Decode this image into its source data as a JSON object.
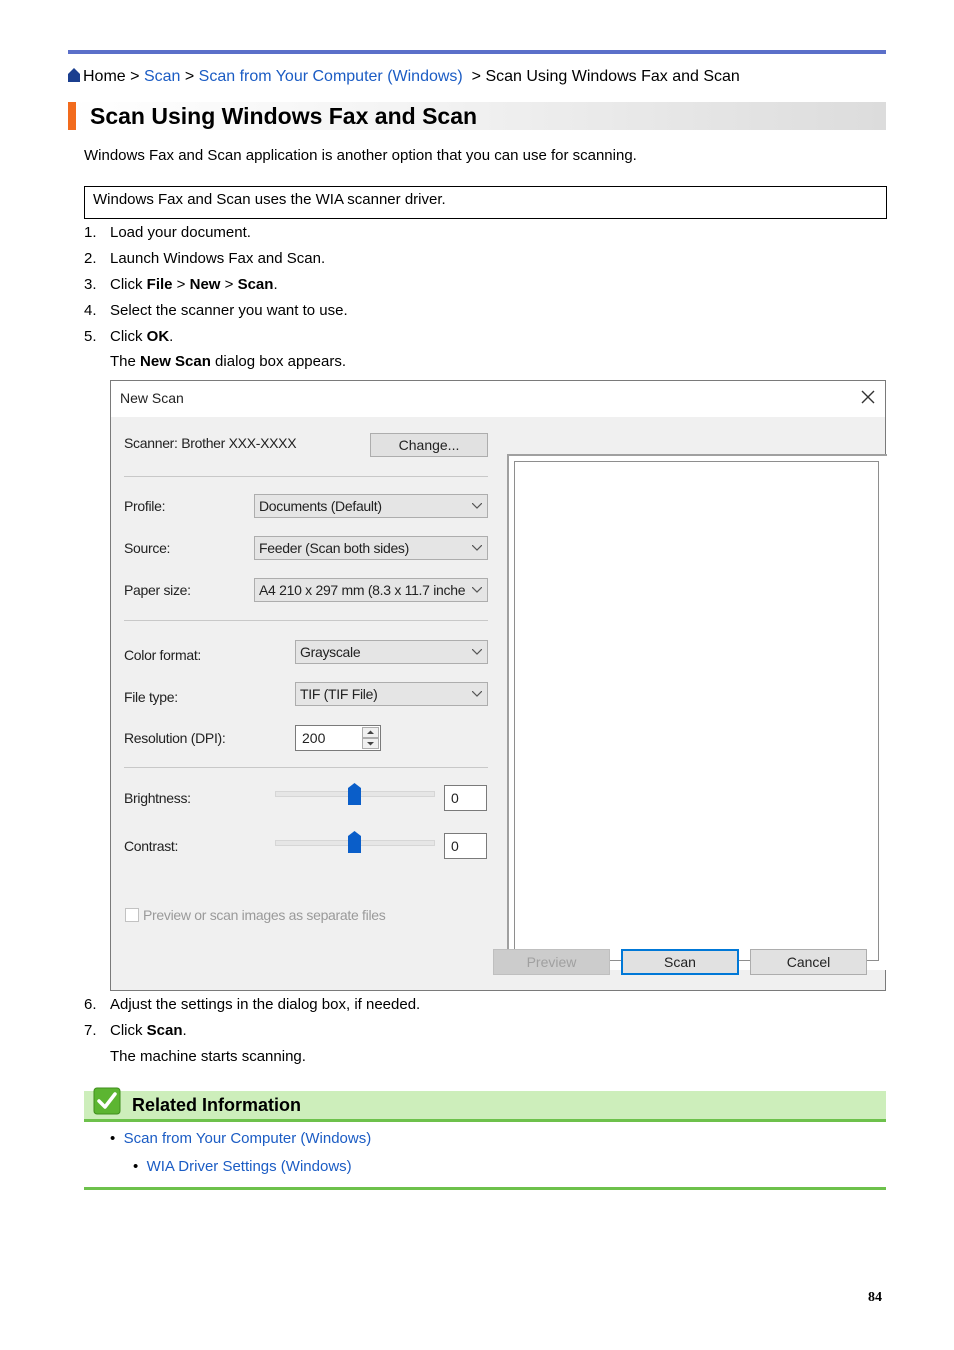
{
  "breadcrumb": {
    "home": "Home",
    "sep": ">",
    "scan": "Scan",
    "scan_from_computer": "Scan from Your Computer (Windows)",
    "current": "Scan Using Windows Fax and Scan"
  },
  "title": "Scan Using Windows Fax and Scan",
  "intro": "Windows Fax and Scan application is another option that you can use for scanning.",
  "note": "Windows Fax and Scan uses the WIA scanner driver.",
  "steps": [
    {
      "num": "1.",
      "text": "Load your document."
    },
    {
      "num": "2.",
      "text": "Launch Windows Fax and Scan."
    },
    {
      "num": "3.",
      "pre": "Click ",
      "b1": "File",
      "m1": " > ",
      "b2": "New",
      "m2": " > ",
      "b3": "Scan",
      "post": "."
    },
    {
      "num": "4.",
      "text": "Select the scanner you want to use."
    },
    {
      "num": "5.",
      "pre": "Click ",
      "b1": "OK",
      "post": "."
    },
    {
      "num": "6.",
      "text": "Adjust the settings in the dialog box, if needed."
    },
    {
      "num": "7.",
      "pre": "Click ",
      "b1": "Scan",
      "post": "."
    }
  ],
  "step5_result": {
    "pre": "The ",
    "bold": "New Scan",
    "post": " dialog box appears."
  },
  "step7_result": "The machine starts scanning.",
  "dialog": {
    "title": "New Scan",
    "scanner_label": "Scanner: Brother XXX-XXXX",
    "change_button": "Change...",
    "profile_label": "Profile:",
    "profile_value": "Documents (Default)",
    "source_label": "Source:",
    "source_value": "Feeder (Scan both sides)",
    "paper_label": "Paper size:",
    "paper_value": "A4 210 x 297 mm (8.3 x 11.7 inche",
    "color_label": "Color format:",
    "color_value": "Grayscale",
    "filetype_label": "File type:",
    "filetype_value": "TIF (TIF File)",
    "resolution_label": "Resolution (DPI):",
    "resolution_value": "200",
    "brightness_label": "Brightness:",
    "brightness_value": "0",
    "contrast_label": "Contrast:",
    "contrast_value": "0",
    "separate_files_label": "Preview or scan images as separate files",
    "preview_button": "Preview",
    "scan_button": "Scan",
    "cancel_button": "Cancel"
  },
  "related": {
    "title": "Related Information",
    "links": [
      "Scan from Your Computer (Windows)",
      "WIA Driver Settings (Windows)"
    ],
    "bullet": "•"
  },
  "page_number": "84",
  "colors": {
    "link": "#1b5cc4",
    "accent_orange": "#f26b1d",
    "top_rule": "#5b6fc9",
    "related_green": "#6dc14b",
    "related_bg": "#cdeebb"
  }
}
